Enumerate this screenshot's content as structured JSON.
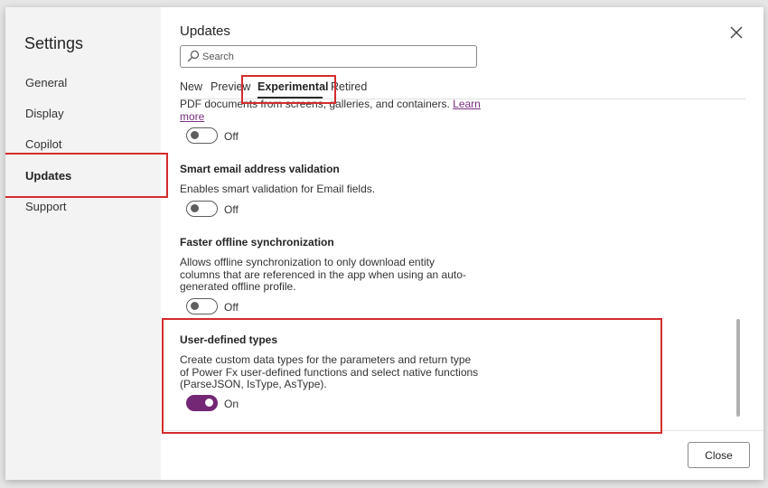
{
  "sidebar": {
    "title": "Settings",
    "items": [
      {
        "label": "General"
      },
      {
        "label": "Display"
      },
      {
        "label": "Copilot"
      },
      {
        "label": "Updates"
      },
      {
        "label": "Support"
      }
    ]
  },
  "main": {
    "title": "Updates",
    "search": {
      "placeholder": "Search",
      "value": ""
    },
    "tabs": [
      {
        "label": "New"
      },
      {
        "label": "Preview"
      },
      {
        "label": "Experimental"
      },
      {
        "label": "Retired"
      }
    ],
    "active_tab": "Experimental",
    "settings": [
      {
        "title": "",
        "description": "PDF documents from screens, galleries, and containers.",
        "link": "Learn more",
        "toggle_state": "Off"
      },
      {
        "title": "Smart email address validation",
        "description": "Enables smart validation for Email fields.",
        "toggle_state": "Off"
      },
      {
        "title": "Faster offline synchronization",
        "description_lines": [
          "Allows offline synchronization to only download entity",
          "columns that are referenced in the app when using an auto-",
          "generated offline profile."
        ],
        "toggle_state": "Off"
      },
      {
        "title": "User-defined types",
        "description_lines": [
          "Create custom data types for the parameters and return type",
          "of Power Fx user-defined functions and select native functions",
          "(ParseJSON, IsType, AsType)."
        ],
        "toggle_state": "On"
      }
    ]
  },
  "footer": {
    "close_label": "Close"
  },
  "colors": {
    "accent": "#742774",
    "highlight": "#d42c2c",
    "link": "#7a2e82"
  },
  "icons": {
    "search": "search-icon",
    "close": "close-icon"
  }
}
